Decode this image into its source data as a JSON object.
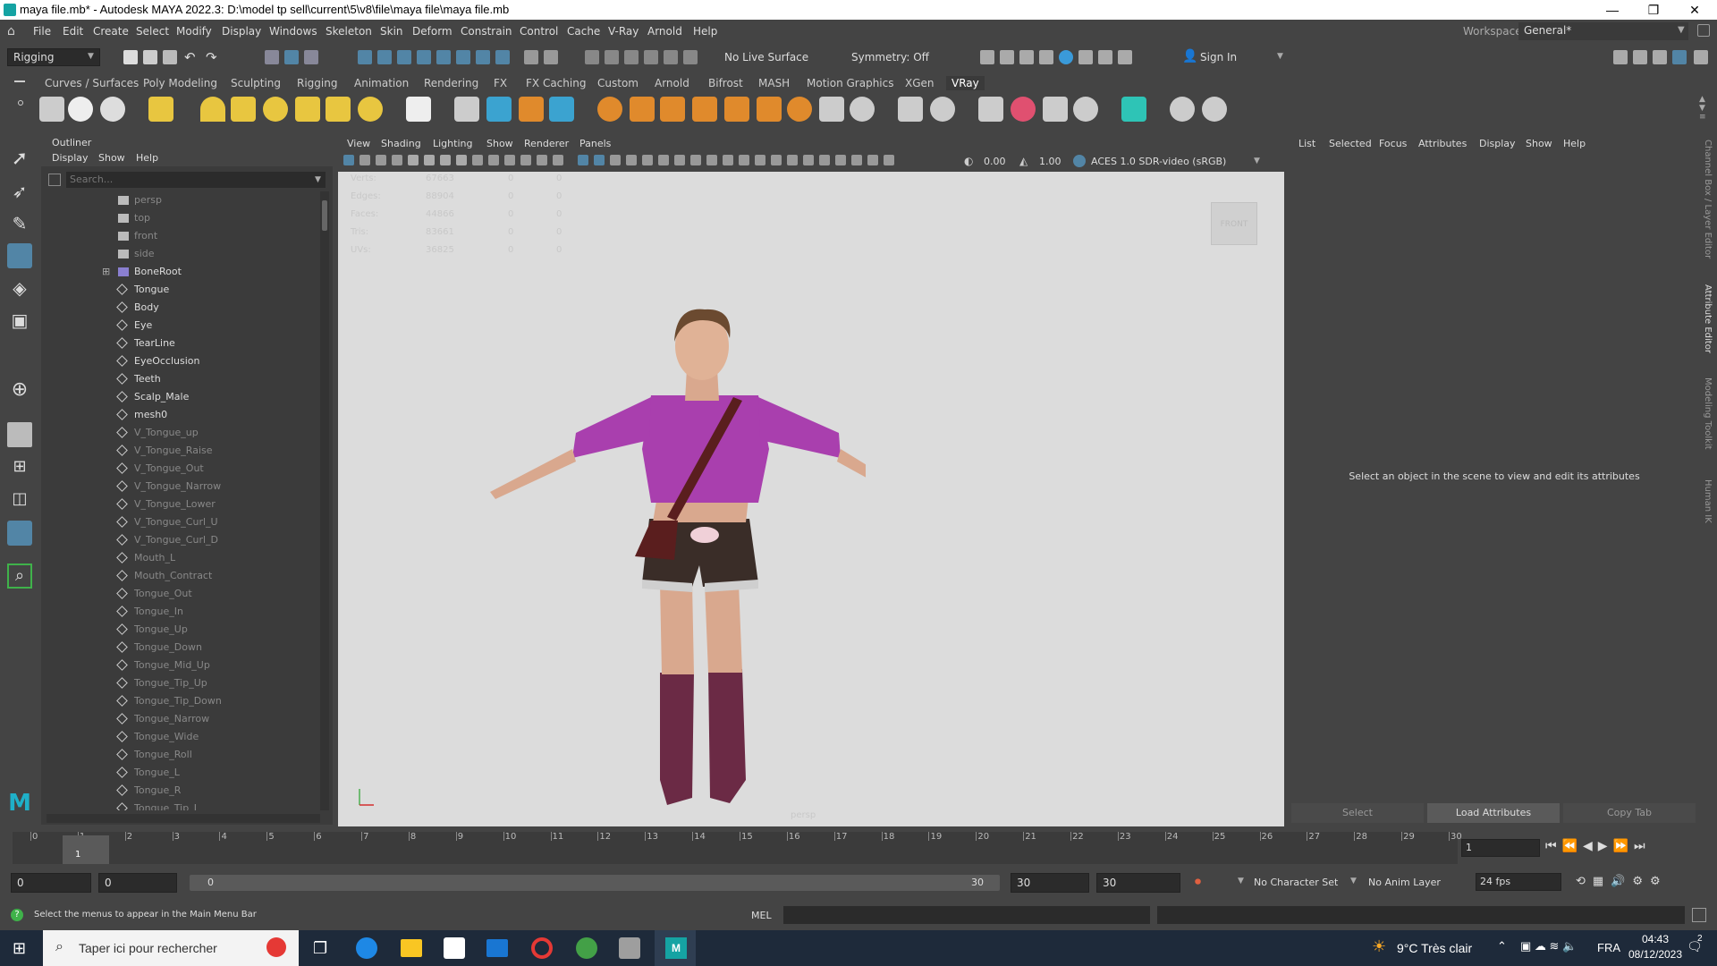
{
  "window": {
    "title": "maya file.mb* - Autodesk MAYA 2022.3: D:\\model tp sell\\current\\5\\v8\\file\\maya file\\maya file.mb",
    "minimize": "—",
    "maximize": "❐",
    "close": "✕"
  },
  "menubar": {
    "items": [
      "File",
      "Edit",
      "Create",
      "Select",
      "Modify",
      "Display",
      "Windows",
      "Skeleton",
      "Skin",
      "Deform",
      "Constrain",
      "Control",
      "Cache",
      "V-Ray",
      "Arnold",
      "Help"
    ],
    "workspace_label": "Workspace:",
    "workspace_value": "General*"
  },
  "statusline": {
    "mode": "Rigging",
    "live_surface": "No Live Surface",
    "symmetry": "Symmetry: Off",
    "sign_in": "Sign In"
  },
  "shelf": {
    "tabs": [
      "Curves / Surfaces",
      "Poly Modeling",
      "Sculpting",
      "Rigging",
      "Animation",
      "Rendering",
      "FX",
      "FX Caching",
      "Custom",
      "Arnold",
      "Bifrost",
      "MASH",
      "Motion Graphics",
      "XGen",
      "VRay"
    ],
    "active_tab": "VRay"
  },
  "outliner": {
    "title": "Outliner",
    "menus": [
      "Display",
      "Show",
      "Help"
    ],
    "search_placeholder": "Search...",
    "items": [
      {
        "label": "persp",
        "type": "camera",
        "dim": true
      },
      {
        "label": "top",
        "type": "camera",
        "dim": true
      },
      {
        "label": "front",
        "type": "camera",
        "dim": true
      },
      {
        "label": "side",
        "type": "camera",
        "dim": true
      },
      {
        "label": "BoneRoot",
        "type": "joint",
        "dim": false,
        "expand": "⊞"
      },
      {
        "label": "Tongue",
        "type": "mesh",
        "dim": false
      },
      {
        "label": "Body",
        "type": "mesh",
        "dim": false
      },
      {
        "label": "Eye",
        "type": "mesh",
        "dim": false
      },
      {
        "label": "TearLine",
        "type": "mesh",
        "dim": false
      },
      {
        "label": "EyeOcclusion",
        "type": "mesh",
        "dim": false
      },
      {
        "label": "Teeth",
        "type": "mesh",
        "dim": false
      },
      {
        "label": "Scalp_Male",
        "type": "mesh",
        "dim": false
      },
      {
        "label": "mesh0",
        "type": "mesh",
        "dim": false
      },
      {
        "label": "V_Tongue_up",
        "type": "mesh",
        "dim": true
      },
      {
        "label": "V_Tongue_Raise",
        "type": "mesh",
        "dim": true
      },
      {
        "label": "V_Tongue_Out",
        "type": "mesh",
        "dim": true
      },
      {
        "label": "V_Tongue_Narrow",
        "type": "mesh",
        "dim": true
      },
      {
        "label": "V_Tongue_Lower",
        "type": "mesh",
        "dim": true
      },
      {
        "label": "V_Tongue_Curl_U",
        "type": "mesh",
        "dim": true
      },
      {
        "label": "V_Tongue_Curl_D",
        "type": "mesh",
        "dim": true
      },
      {
        "label": "Mouth_L",
        "type": "mesh",
        "dim": true
      },
      {
        "label": "Mouth_Contract",
        "type": "mesh",
        "dim": true
      },
      {
        "label": "Tongue_Out",
        "type": "mesh",
        "dim": true
      },
      {
        "label": "Tongue_In",
        "type": "mesh",
        "dim": true
      },
      {
        "label": "Tongue_Up",
        "type": "mesh",
        "dim": true
      },
      {
        "label": "Tongue_Down",
        "type": "mesh",
        "dim": true
      },
      {
        "label": "Tongue_Mid_Up",
        "type": "mesh",
        "dim": true
      },
      {
        "label": "Tongue_Tip_Up",
        "type": "mesh",
        "dim": true
      },
      {
        "label": "Tongue_Tip_Down",
        "type": "mesh",
        "dim": true
      },
      {
        "label": "Tongue_Narrow",
        "type": "mesh",
        "dim": true
      },
      {
        "label": "Tongue_Wide",
        "type": "mesh",
        "dim": true
      },
      {
        "label": "Tongue_Roll",
        "type": "mesh",
        "dim": true
      },
      {
        "label": "Tongue_L",
        "type": "mesh",
        "dim": true
      },
      {
        "label": "Tongue_R",
        "type": "mesh",
        "dim": true
      },
      {
        "label": "Tongue_Tip_L",
        "type": "mesh",
        "dim": true
      }
    ]
  },
  "viewport": {
    "menus": [
      "View",
      "Shading",
      "Lighting",
      "Show",
      "Renderer",
      "Panels"
    ],
    "exposure": "0.00",
    "gamma": "1.00",
    "color_space": "ACES 1.0 SDR-video (sRGB)",
    "hud_stats": [
      [
        "Verts:",
        "67663",
        "0",
        "0"
      ],
      [
        "Edges:",
        "88904",
        "0",
        "0"
      ],
      [
        "Faces:",
        "44866",
        "0",
        "0"
      ],
      [
        "Tris:",
        "83661",
        "0",
        "0"
      ],
      [
        "UVs:",
        "36825",
        "0",
        "0"
      ]
    ],
    "view_cube": "FRONT",
    "camera_label": "persp"
  },
  "attribute_editor": {
    "menus": [
      "List",
      "Selected",
      "Focus",
      "Attributes",
      "Display",
      "Show",
      "Help"
    ],
    "message": "Select an object in the scene to view and edit its attributes",
    "buttons": [
      "Select",
      "Load Attributes",
      "Copy Tab"
    ],
    "side_tabs": [
      "Channel Box / Layer Editor",
      "Attribute Editor",
      "Modeling Toolkit",
      "Human IK"
    ]
  },
  "timeline": {
    "ticks": [
      "0",
      "1",
      "2",
      "3",
      "4",
      "5",
      "6",
      "7",
      "8",
      "9",
      "10",
      "11",
      "12",
      "13",
      "14",
      "15",
      "16",
      "17",
      "18",
      "19",
      "20",
      "21",
      "22",
      "23",
      "24",
      "25",
      "26",
      "27",
      "28",
      "29",
      "30"
    ],
    "current_frame_marker": "1",
    "current_frame": "1"
  },
  "range": {
    "start": "0",
    "playback_start": "0",
    "slider_start": "0",
    "slider_end": "30",
    "playback_end": "30",
    "end": "30",
    "character_set": "No Character Set",
    "anim_layer": "No Anim Layer",
    "fps": "24 fps"
  },
  "commandline": {
    "help_text": "Select the menus to appear in the Main Menu Bar",
    "language": "MEL"
  },
  "taskbar": {
    "search_placeholder": "Taper ici pour rechercher",
    "weather": "9°C  Très clair",
    "language": "FRA",
    "time": "04:43",
    "date": "08/12/2023",
    "notifications": "2"
  },
  "colors": {
    "maya_bg": "#444444",
    "panel_bg": "#3b3b3b",
    "viewport_bg": "#dcdcdc",
    "accent_blue": "#5285a6",
    "taskbar_bg": "#1e2a3a"
  }
}
